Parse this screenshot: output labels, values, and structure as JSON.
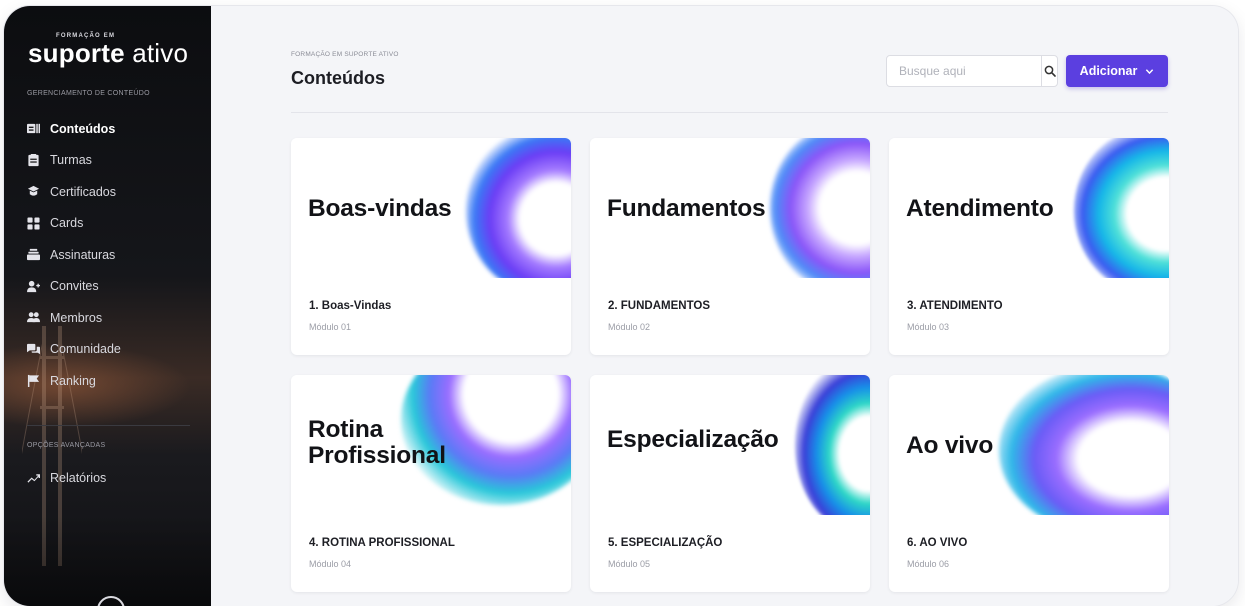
{
  "brand": {
    "small": "FORMAÇÃO EM",
    "name_bold": "suporte",
    "name_light": "ativo"
  },
  "sidebar": {
    "section_main": "GERENCIAMENTO DE CONTEÚDO",
    "items": [
      {
        "label": "Conteúdos",
        "icon": "contents-icon",
        "active": true
      },
      {
        "label": "Turmas",
        "icon": "classes-icon"
      },
      {
        "label": "Certificados",
        "icon": "certificate-icon"
      },
      {
        "label": "Cards",
        "icon": "cards-icon"
      },
      {
        "label": "Assinaturas",
        "icon": "subscriptions-icon"
      },
      {
        "label": "Convites",
        "icon": "invite-icon"
      },
      {
        "label": "Membros",
        "icon": "members-icon"
      },
      {
        "label": "Comunidade",
        "icon": "community-icon"
      },
      {
        "label": "Ranking",
        "icon": "flag-icon"
      }
    ],
    "section_advanced": "OPÇÕES AVANÇADAS",
    "advanced_items": [
      {
        "label": "Relatórios",
        "icon": "trend-icon"
      }
    ]
  },
  "header": {
    "breadcrumb": "FORMAÇÃO EM SUPORTE ATIVO",
    "title": "Conteúdos",
    "search_placeholder": "Busque aqui",
    "add_label": "Adicionar"
  },
  "colors": {
    "accent": "#5b3fe0",
    "sidebar_bg": "#111216",
    "page_bg": "#f4f5f8"
  },
  "cards": [
    {
      "thumb_text": "Boas-vindas",
      "title": "1. Boas-Vindas",
      "subtitle": "Módulo 01"
    },
    {
      "thumb_text": "Fundamentos",
      "title": "2. FUNDAMENTOS",
      "subtitle": "Módulo 02"
    },
    {
      "thumb_text": "Atendimento",
      "title": "3. ATENDIMENTO",
      "subtitle": "Módulo 03"
    },
    {
      "thumb_text_line1": "Rotina",
      "thumb_text_line2": "Profissional",
      "title": "4. ROTINA PROFISSIONAL",
      "subtitle": "Módulo 04"
    },
    {
      "thumb_text": "Especialização",
      "title": "5. ESPECIALIZAÇÃO",
      "subtitle": "Módulo 05"
    },
    {
      "thumb_text": "Ao vivo",
      "title": "6. AO VIVO",
      "subtitle": "Módulo 06"
    }
  ]
}
